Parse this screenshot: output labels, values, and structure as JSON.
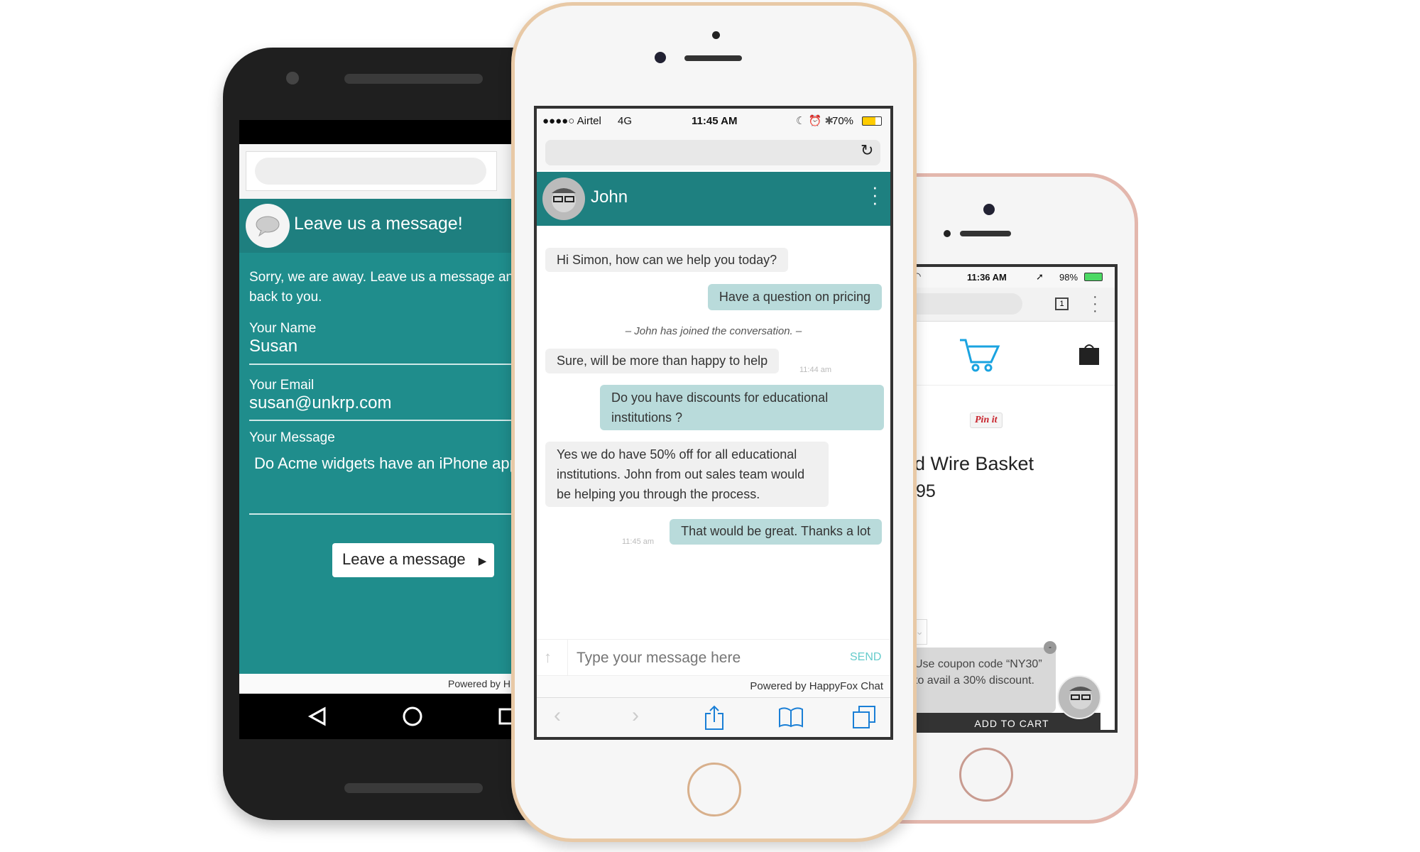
{
  "android": {
    "header_title": "Leave us a message!",
    "away_text_line1": "Sorry, we are away. Leave us a message an",
    "away_text_line2": "back to you.",
    "name_label": "Your Name",
    "name_value": "Susan",
    "email_label": "Your Email",
    "email_value": "susan@unkrp.com",
    "message_label": "Your Message",
    "message_value": "Do Acme widgets have an iPhone app",
    "submit_label": "Leave a message",
    "powered_by": "Powered by H",
    "colors": {
      "header": "#1e7f7f",
      "body": "#1f8d8c"
    }
  },
  "chat": {
    "status": {
      "carrier": "●●●●○ Airtel",
      "network": "4G",
      "time": "11:45 AM",
      "battery": "70%"
    },
    "agent_name": "John",
    "messages": [
      {
        "from": "agent",
        "text": "Hi Simon, how can we help you today?"
      },
      {
        "from": "user",
        "text": "Have a question on pricing"
      },
      {
        "from": "system",
        "text": "– John has joined the conversation. –"
      },
      {
        "from": "agent",
        "text": "Sure, will be more than happy to help",
        "time": "11:44 am"
      },
      {
        "from": "user",
        "text": "Do you have discounts for educational institutions ?"
      },
      {
        "from": "agent",
        "text": "Yes we do have 50% off for all educational institutions. John from out sales team would be helping you through the process."
      },
      {
        "from": "user",
        "text": "That would be great. Thanks a lot",
        "time": "11:45 am"
      }
    ],
    "input_placeholder": "Type your message here",
    "send_label": "SEND",
    "powered_by": "Powered by HappyFox Chat",
    "colors": {
      "header": "#1e8080",
      "user_bubble": "#b9dbdb",
      "agent_bubble": "#f0f0f0"
    }
  },
  "shop": {
    "status": {
      "time": "11:36 AM",
      "battery": "98%"
    },
    "tab_count": "1",
    "pin_label": "Pin it",
    "product_title": "d Wire Basket",
    "price": "95",
    "coupon_text": "Use coupon code “NY30” to avail a 30% discount.",
    "minimize_label": "-",
    "add_to_cart": "ADD TO CART",
    "colors": {
      "cart": "#1aa3e0"
    }
  }
}
